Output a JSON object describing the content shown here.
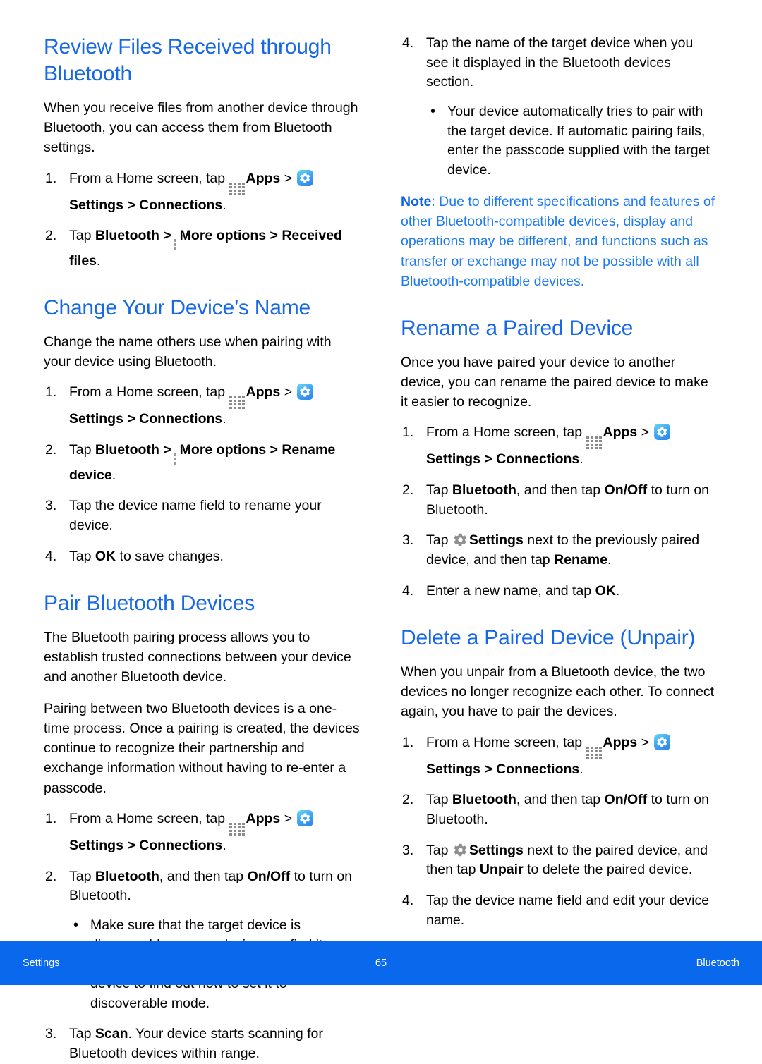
{
  "colors": {
    "heading_blue": "#1668E8",
    "note_blue": "#1F7BF0",
    "footer_blue": "#0A68EC",
    "apps_icon_gray": "#8a8a8a",
    "gear_gray": "#8f8f8f"
  },
  "icons": {
    "apps": "apps-grid-icon",
    "settings_app": "settings-app-icon",
    "gear": "gear-icon",
    "more_options": "more-options-icon"
  },
  "left_column": {
    "section1": {
      "title": "Review Files Received through Bluetooth",
      "intro": "When you receive files from another device through Bluetooth, you can access them from Bluetooth settings.",
      "steps": {
        "s1_a": "From a Home screen, tap",
        "s1_apps": "Apps",
        "s1_gt1": ">",
        "s1_settings": "Settings",
        "s1_tail": "> Connections",
        "s1_period": ".",
        "s2_tap": "Tap",
        "s2_bluetooth": "Bluetooth",
        "s2_gt": ">",
        "s2_more": "More options",
        "s2_gt2": ">",
        "s2_received": "Received files",
        "s2_period": "."
      }
    },
    "section2": {
      "title": "Change Your Device’s Name",
      "intro": "Change the name others use when pairing with your device using Bluetooth.",
      "steps": {
        "s1_a": "From a Home screen, tap",
        "s1_apps": "Apps",
        "s1_gt1": ">",
        "s1_settings": "Settings",
        "s1_tail": "> Connections",
        "s1_period": ".",
        "s2_tap": "Tap",
        "s2_bluetooth": "Bluetooth",
        "s2_gt": ">",
        "s2_more": "More options",
        "s2_gt2": ">",
        "s2_rename": "Rename device",
        "s2_period": ".",
        "s3": "Tap the device name field to rename your device.",
        "s4_a": "Tap",
        "s4_ok": "OK",
        "s4_b": "to save changes."
      }
    },
    "section3": {
      "title": "Pair Bluetooth Devices",
      "intro1": "The Bluetooth pairing process allows you to establish trusted connections between your device and another Bluetooth device.",
      "intro2": "Pairing between two Bluetooth devices is a one-time process. Once a pairing is created, the devices continue to recognize their partnership and exchange information without having to re-enter a passcode.",
      "steps": {
        "s1_a": "From a Home screen, tap",
        "s1_apps": "Apps",
        "s1_gt1": ">",
        "s1_settings": "Settings",
        "s1_tail": "> Connections",
        "s1_period": ".",
        "s2_tap": "Tap",
        "s2_bluetooth": "Bluetooth",
        "s2_mid": ", and then tap",
        "s2_onoff": "On/Off",
        "s2_end": "to turn on Bluetooth.",
        "s2_bullet": "Make sure that the target device is discoverable so your device can find it. Refer to the instructions that came with the device to find out how to set it to discoverable mode.",
        "s3_a": "Tap",
        "s3_scan": "Scan",
        "s3_b": ". Your device starts scanning for Bluetooth devices within range."
      }
    }
  },
  "right_column": {
    "continued": {
      "step4_num": "4.",
      "step4": "Tap the name of the target device when you see it displayed in the Bluetooth devices section.",
      "bullet": "Your device automatically tries to pair with the target device. If automatic pairing fails, enter the passcode supplied with the target device.",
      "note_label": "Note",
      "note_body": ": Due to different specifications and features of other Bluetooth-compatible devices, display and operations may be different, and functions such as transfer or exchange may not be possible with all Bluetooth-compatible devices."
    },
    "section1": {
      "title": "Rename a Paired Device",
      "intro": "Once you have paired your device to another device, you can rename the paired device to make it easier to recognize.",
      "steps": {
        "s1_a": "From a Home screen, tap",
        "s1_apps": "Apps",
        "s1_gt1": ">",
        "s1_settings": "Settings",
        "s1_tail": "> Connections",
        "s1_period": ".",
        "s2_tap": "Tap",
        "s2_bluetooth": "Bluetooth",
        "s2_mid": ", and then tap",
        "s2_onoff": "On/Off",
        "s2_end": "to turn on Bluetooth.",
        "s3_tap": "Tap",
        "s3_settings": "Settings",
        "s3_mid": "next to the previously paired device, and then tap",
        "s3_rename": "Rename",
        "s3_period": ".",
        "s4_a": "Enter a new name, and tap",
        "s4_ok": "OK",
        "s4_period": "."
      }
    },
    "section2": {
      "title": "Delete a Paired Device (Unpair)",
      "intro": "When you unpair from a Bluetooth device, the two devices no longer recognize each other. To connect again, you have to pair the devices.",
      "steps": {
        "s1_a": "From a Home screen, tap",
        "s1_apps": "Apps",
        "s1_gt1": ">",
        "s1_settings": "Settings",
        "s1_tail": "> Connections",
        "s1_period": ".",
        "s2_tap": "Tap",
        "s2_bluetooth": "Bluetooth",
        "s2_mid": ", and then tap",
        "s2_onoff": "On/Off",
        "s2_end": "to turn on Bluetooth.",
        "s3_tap": "Tap",
        "s3_settings": "Settings",
        "s3_mid": "next to the paired device, and then tap",
        "s3_unpair": "Unpair",
        "s3_end": "to delete the paired device.",
        "s4": "Tap the device name field and edit your device name."
      }
    }
  },
  "footer": {
    "left": "Settings",
    "page_number": "65",
    "right": "Bluetooth"
  }
}
